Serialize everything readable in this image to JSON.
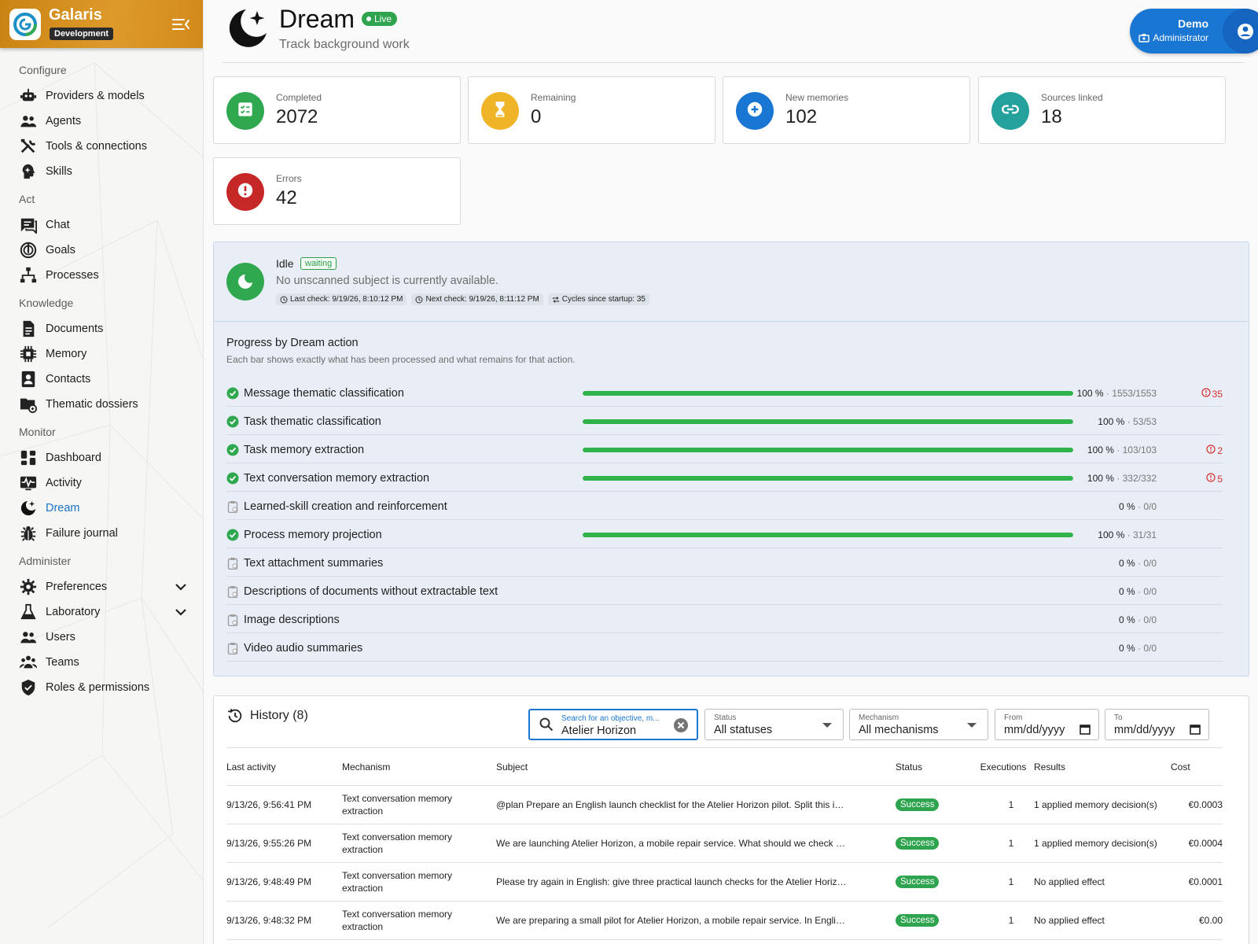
{
  "app": {
    "name": "Galaris",
    "environment": "Development"
  },
  "sidebar": {
    "sections": [
      {
        "title": "Configure",
        "items": [
          {
            "label": "Providers & models",
            "icon": "robot-icon"
          },
          {
            "label": "Agents",
            "icon": "people-icon"
          },
          {
            "label": "Tools & connections",
            "icon": "tools-icon"
          },
          {
            "label": "Skills",
            "icon": "skills-head-icon"
          }
        ]
      },
      {
        "title": "Act",
        "items": [
          {
            "label": "Chat",
            "icon": "chat-icon"
          },
          {
            "label": "Goals",
            "icon": "goals-icon"
          },
          {
            "label": "Processes",
            "icon": "process-tree-icon"
          }
        ]
      },
      {
        "title": "Knowledge",
        "items": [
          {
            "label": "Documents",
            "icon": "document-icon"
          },
          {
            "label": "Memory",
            "icon": "memory-chip-icon"
          },
          {
            "label": "Contacts",
            "icon": "contacts-icon"
          },
          {
            "label": "Thematic dossiers",
            "icon": "folder-icon"
          }
        ]
      },
      {
        "title": "Monitor",
        "items": [
          {
            "label": "Dashboard",
            "icon": "dashboard-icon"
          },
          {
            "label": "Activity",
            "icon": "activity-icon"
          },
          {
            "label": "Dream",
            "icon": "moon-star-icon",
            "active": true
          },
          {
            "label": "Failure journal",
            "icon": "bug-icon"
          }
        ]
      },
      {
        "title": "Administer",
        "items": [
          {
            "label": "Preferences",
            "icon": "gear-icon",
            "expandable": true
          },
          {
            "label": "Laboratory",
            "icon": "flask-icon",
            "expandable": true
          },
          {
            "label": "Users",
            "icon": "users-icon"
          },
          {
            "label": "Teams",
            "icon": "teams-icon"
          },
          {
            "label": "Roles & permissions",
            "icon": "shield-check-icon"
          }
        ]
      }
    ]
  },
  "header": {
    "title": "Dream",
    "live_badge": "Live",
    "subtitle": "Track background work"
  },
  "user": {
    "name": "Demo",
    "role": "Administrator"
  },
  "stats": [
    {
      "label": "Completed",
      "value": "2072",
      "color": "#2fa84f",
      "icon": "checklist-icon"
    },
    {
      "label": "Remaining",
      "value": "0",
      "color": "#f0b429",
      "icon": "hourglass-icon"
    },
    {
      "label": "New memories",
      "value": "102",
      "color": "#1976d2",
      "icon": "plus-circle-icon"
    },
    {
      "label": "Sources linked",
      "value": "18",
      "color": "#24a19c",
      "icon": "link-icon"
    },
    {
      "label": "Errors",
      "value": "42",
      "color": "#c62828",
      "icon": "alert-icon"
    }
  ],
  "status": {
    "state": "Idle",
    "badge": "waiting",
    "message": "No unscanned subject is currently available.",
    "last_check": "Last check: 9/19/26, 8:10:12 PM",
    "next_check": "Next check: 9/19/26, 8:11:12 PM",
    "cycles": "Cycles since startup: 35"
  },
  "progress": {
    "title": "Progress by Dream action",
    "subtitle": "Each bar shows exactly what has been processed and what remains for that action.",
    "rows": [
      {
        "name": "Message thematic classification",
        "done": true,
        "fraction": 1.0,
        "pct": "100 %",
        "count": "1553/1553",
        "errors": "35"
      },
      {
        "name": "Task thematic classification",
        "done": true,
        "fraction": 1.0,
        "pct": "100 %",
        "count": "53/53",
        "errors": ""
      },
      {
        "name": "Task memory extraction",
        "done": true,
        "fraction": 1.0,
        "pct": "100 %",
        "count": "103/103",
        "errors": "2"
      },
      {
        "name": "Text conversation memory extraction",
        "done": true,
        "fraction": 1.0,
        "pct": "100 %",
        "count": "332/332",
        "errors": "5"
      },
      {
        "name": "Learned-skill creation and reinforcement",
        "done": false,
        "fraction": 0,
        "pct": "0 %",
        "count": "0/0",
        "errors": ""
      },
      {
        "name": "Process memory projection",
        "done": true,
        "fraction": 1.0,
        "pct": "100 %",
        "count": "31/31",
        "errors": ""
      },
      {
        "name": "Text attachment summaries",
        "done": false,
        "fraction": 0,
        "pct": "0 %",
        "count": "0/0",
        "errors": ""
      },
      {
        "name": "Descriptions of documents without extractable text",
        "done": false,
        "fraction": 0,
        "pct": "0 %",
        "count": "0/0",
        "errors": ""
      },
      {
        "name": "Image descriptions",
        "done": false,
        "fraction": 0,
        "pct": "0 %",
        "count": "0/0",
        "errors": ""
      },
      {
        "name": "Video audio summaries",
        "done": false,
        "fraction": 0,
        "pct": "0 %",
        "count": "0/0",
        "errors": ""
      }
    ]
  },
  "history": {
    "title": "History (8)",
    "search": {
      "label": "Search for an objective, m...",
      "value": "Atelier Horizon"
    },
    "status_filter": {
      "label": "Status",
      "value": "All statuses"
    },
    "mechanism_filter": {
      "label": "Mechanism",
      "value": "All mechanisms"
    },
    "from": {
      "label": "From",
      "value": "mm/dd/yyyy"
    },
    "to": {
      "label": "To",
      "value": "mm/dd/yyyy"
    },
    "columns": [
      "Last activity",
      "Mechanism",
      "Subject",
      "Status",
      "Executions",
      "Results",
      "Cost"
    ],
    "rows": [
      {
        "time": "9/13/26, 9:56:41 PM",
        "mechanism": "Text conversation memory extraction",
        "subject": "@plan Prepare an English launch checklist for the Atelier Horizon pilot. Split this i…",
        "status": "Success",
        "executions": "1",
        "results": "1 applied memory decision(s)",
        "cost": "€0.0003"
      },
      {
        "time": "9/13/26, 9:55:26 PM",
        "mechanism": "Text conversation memory extraction",
        "subject": "We are launching Atelier Horizon, a mobile repair service. What should we check …",
        "status": "Success",
        "executions": "1",
        "results": "1 applied memory decision(s)",
        "cost": "€0.0004"
      },
      {
        "time": "9/13/26, 9:48:49 PM",
        "mechanism": "Text conversation memory extraction",
        "subject": "Please try again in English: give three practical launch checks for the Atelier Horiz…",
        "status": "Success",
        "executions": "1",
        "results": "No applied effect",
        "cost": "€0.0001"
      },
      {
        "time": "9/13/26, 9:48:32 PM",
        "mechanism": "Text conversation memory extraction",
        "subject": "We are preparing a small pilot for Atelier Horizon, a mobile repair service. In Engli…",
        "status": "Success",
        "executions": "1",
        "results": "No applied effect",
        "cost": "€0.00"
      }
    ]
  }
}
